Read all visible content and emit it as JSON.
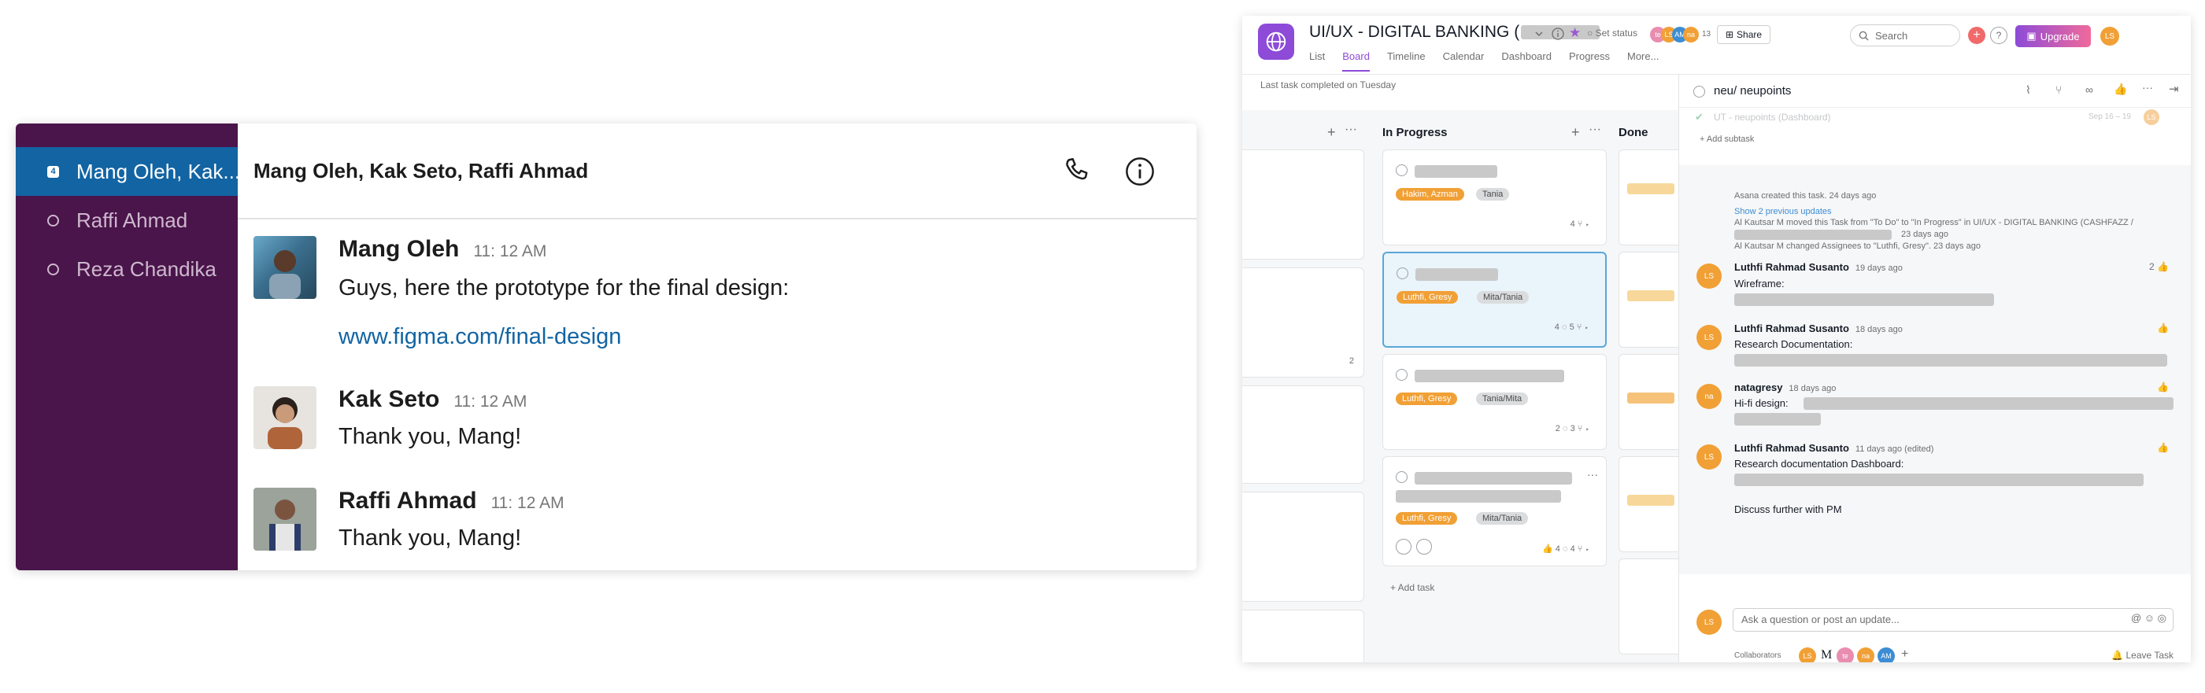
{
  "chat": {
    "sidebar": {
      "items": [
        {
          "label": "Mang Oleh, Kak...",
          "badge": "4",
          "active": true
        },
        {
          "label": "Raffi Ahmad",
          "active": false
        },
        {
          "label": "Reza Chandika",
          "active": false
        }
      ]
    },
    "header": {
      "title": "Mang Oleh, Kak Seto, Raffi Ahmad"
    },
    "messages": [
      {
        "name": "Mang Oleh",
        "time": "11: 12 AM",
        "text": "Guys, here the prototype for the final design:",
        "link": "www.figma.com/final-design"
      },
      {
        "name": "Kak Seto",
        "time": "11: 12 AM",
        "text": "Thank you, Mang!"
      },
      {
        "name": "Raffi Ahmad",
        "time": "11: 12 AM",
        "text": "Thank you, Mang!"
      }
    ]
  },
  "asana": {
    "project_title": "UI/UX - DIGITAL BANKING (",
    "set_status": "Set status",
    "member_count": "13",
    "share_label": "Share",
    "search_placeholder": "Search",
    "upgrade_label": "Upgrade",
    "user_initials": "LS",
    "tabs": [
      "List",
      "Board",
      "Timeline",
      "Calendar",
      "Dashboard",
      "Progress",
      "More..."
    ],
    "active_tab": "Board",
    "last_task": "Last task completed on Tuesday",
    "columns": {
      "in_progress": "In Progress",
      "done": "Done"
    },
    "left_col_comment_count": "2",
    "cards": [
      {
        "tags": [
          "Hakim, Azman",
          "Tania"
        ],
        "subtasks": "4"
      },
      {
        "tags": [
          "Luthfi, Gresy",
          "Mita/Tania"
        ],
        "comments": "4",
        "subtasks": "5"
      },
      {
        "tags": [
          "Luthfi, Gresy",
          "Tania/Mita"
        ],
        "comments": "2",
        "subtasks": "3"
      },
      {
        "tags": [
          "Luthfi, Gresy",
          "Mita/Tania"
        ],
        "comments": "4",
        "subtasks": "4"
      }
    ],
    "add_task": "+ Add task",
    "detail": {
      "title": "neu/ neupoints",
      "subtask_faded": "UT - neupoints (Dashboard)",
      "subtask_date": "Sep 16 – 19",
      "add_subtask": "+ Add subtask",
      "created": "Asana created this task.  24 days ago",
      "show_previous": "Show 2 previous updates",
      "moved_1": "Al Kautsar M moved this Task from \"To Do\" to \"In Progress\" in UI/UX - DIGITAL BANKING (CASHFAZZ /",
      "moved_2": "23 days ago",
      "changed": "Al Kautsar M changed Assignees to \"Luthfi, Gresy\".  23 days ago",
      "comments": [
        {
          "initials": "LS",
          "name": "Luthfi Rahmad Susanto",
          "ago": "19 days ago",
          "text": "Wireframe:",
          "likes": "2"
        },
        {
          "initials": "LS",
          "name": "Luthfi Rahmad Susanto",
          "ago": "18 days ago",
          "text": "Research Documentation:",
          "likes": ""
        },
        {
          "initials": "na",
          "name": "natagresy",
          "ago": "18 days ago",
          "text": "Hi-fi design:",
          "likes": ""
        },
        {
          "initials": "LS",
          "name": "Luthfi Rahmad Susanto",
          "ago": "11 days ago  (edited)",
          "text": "Research documentation Dashboard:",
          "likes": ""
        }
      ],
      "discuss": "Discuss further with PM",
      "comment_placeholder": "Ask a question or post an update...",
      "collaborators_label": "Collaborators",
      "leave_task": "Leave Task"
    }
  }
}
